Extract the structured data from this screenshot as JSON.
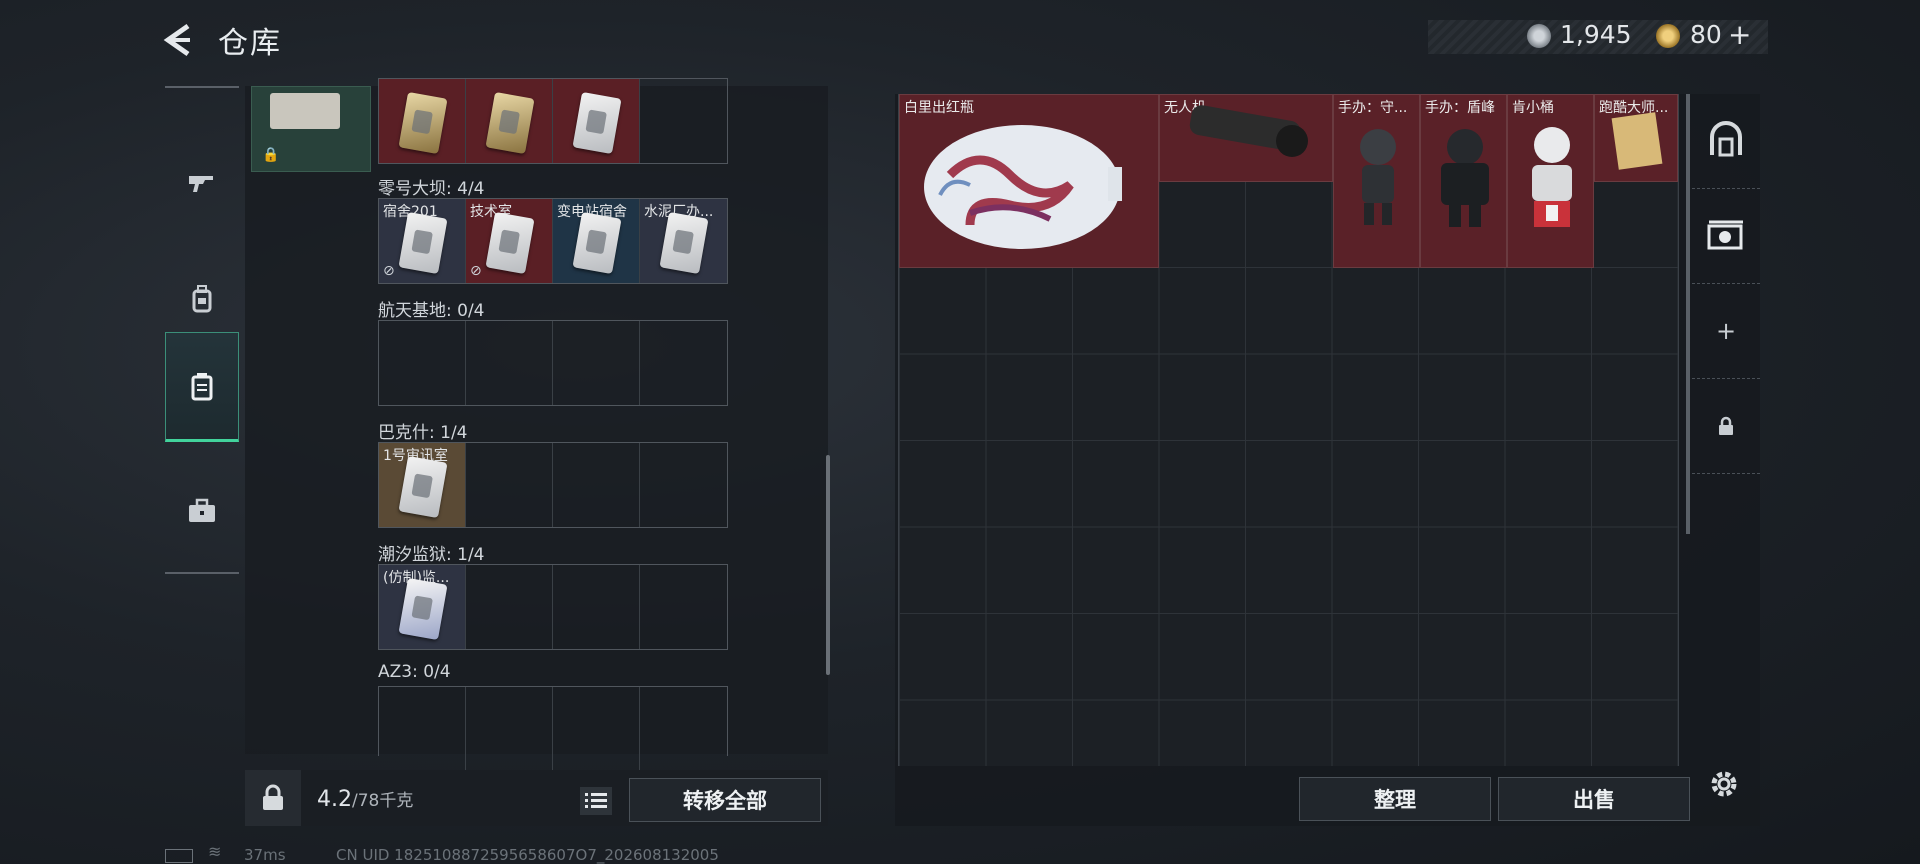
{
  "header": {
    "title": "仓库"
  },
  "currency": {
    "silver": "1,945",
    "gold": "80",
    "gold_plus": "+"
  },
  "left_tabs": [
    "weapon",
    "backpack",
    "keycard-case",
    "toolbox"
  ],
  "stash": {
    "sections": [
      {
        "label": "",
        "slots": [
          {
            "name": "",
            "color": "red",
            "card": "gold"
          },
          {
            "name": "",
            "color": "red",
            "card": "gold"
          },
          {
            "name": "",
            "color": "red",
            "card": "white"
          },
          {
            "name": "",
            "color": "empty",
            "card": ""
          }
        ]
      },
      {
        "label": "零号大坝: 4/4",
        "slots": [
          {
            "name": "宿舍201",
            "color": "slate",
            "card": "white",
            "mark": "⊘"
          },
          {
            "name": "技术室",
            "color": "red",
            "card": "white",
            "mark": "⊘"
          },
          {
            "name": "变电站宿舍",
            "color": "blue",
            "card": "white"
          },
          {
            "name": "水泥厂办...",
            "color": "slate",
            "card": "white"
          }
        ]
      },
      {
        "label": "航天基地: 0/4",
        "slots": [
          {
            "name": "",
            "color": "empty",
            "card": ""
          },
          {
            "name": "",
            "color": "empty",
            "card": ""
          },
          {
            "name": "",
            "color": "empty",
            "card": ""
          },
          {
            "name": "",
            "color": "empty",
            "card": ""
          }
        ]
      },
      {
        "label": "巴克什: 1/4",
        "slots": [
          {
            "name": "1号审讯室",
            "color": "gold",
            "card": "white"
          },
          {
            "name": "",
            "color": "empty",
            "card": ""
          },
          {
            "name": "",
            "color": "empty",
            "card": ""
          },
          {
            "name": "",
            "color": "empty",
            "card": ""
          }
        ]
      },
      {
        "label": "潮汐监狱: 1/4",
        "slots": [
          {
            "name": "(仿制)监...",
            "color": "slate",
            "card": "blue"
          },
          {
            "name": "",
            "color": "empty",
            "card": ""
          },
          {
            "name": "",
            "color": "empty",
            "card": ""
          },
          {
            "name": "",
            "color": "empty",
            "card": ""
          }
        ]
      },
      {
        "label": "AZ3: 0/4",
        "slots": [
          {
            "name": "",
            "color": "empty",
            "card": ""
          },
          {
            "name": "",
            "color": "empty",
            "card": ""
          },
          {
            "name": "",
            "color": "empty",
            "card": ""
          },
          {
            "name": "",
            "color": "empty",
            "card": ""
          }
        ]
      }
    ]
  },
  "bottom_left": {
    "weight_value": "4.2",
    "weight_max": "/78千克",
    "transfer_label": "转移全部"
  },
  "warehouse_items": [
    {
      "name": "白里出红瓶",
      "kind": "vase"
    },
    {
      "name": "无人机",
      "kind": "drone"
    },
    {
      "name": "手办：守...",
      "kind": "figure-dark"
    },
    {
      "name": "手办：盾峰",
      "kind": "figure-armor"
    },
    {
      "name": "肯小桶",
      "kind": "figure-white"
    },
    {
      "name": "跑酷大师...",
      "kind": "paper"
    }
  ],
  "right_sidebar": [
    "backpack-icon",
    "keycard-case-icon",
    "add-icon",
    "lock-icon"
  ],
  "bottom_right": {
    "sort_label": "整理",
    "sell_label": "出售"
  },
  "status_bar": {
    "ping": "37ms",
    "uid": "CN UID 1825108872595658607O7_202608132005"
  },
  "colors": {
    "accent": "#42d39c",
    "item_red": "#5a2128",
    "slot_blue": "#1f3446",
    "slot_gold": "#5a4a35"
  }
}
